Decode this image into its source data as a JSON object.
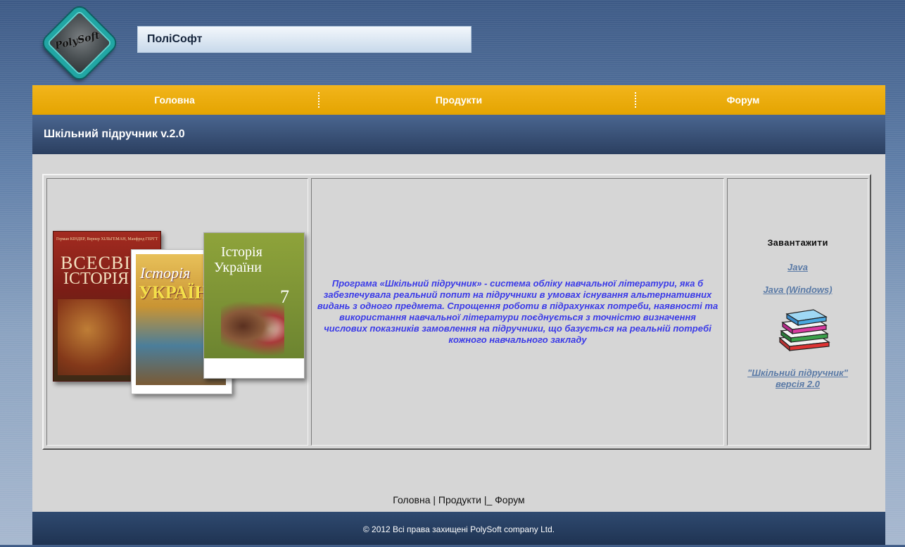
{
  "site": {
    "logo_text": "PolySoft",
    "name": "ПоліСофт"
  },
  "nav": {
    "items": [
      "Головна",
      "Продукти",
      "Форум"
    ]
  },
  "page": {
    "title": "Шкільний підручник v.2.0"
  },
  "books": {
    "book1": {
      "authors": "Герман КІНДЕР, Вернер ХІЛЬГЕМАН, Манфред ГЕРГТ",
      "title1": "ВСЕСВІТНЯ",
      "title2": "ІСТОРІЯ"
    },
    "book2": {
      "title1": "Історія",
      "title2": "УКРАЇНИ"
    },
    "book3": {
      "title1": "Історія",
      "title2": "України",
      "grade": "7"
    }
  },
  "description": "Програма «Шкільний підручник» - система обліку навчальної літератури, яка б забезпечувала реальний попит на підручники в умовах існування альтернативних видань з одного предмета. Спрощення роботи  в підрахунках потреби, наявності та використання навчальної літератури поєднується з точністю визначення числових показників замовлення на підручники, що базується на реальній потребі кожного навчального закладу",
  "download": {
    "title": "Завантажити",
    "java": "Java",
    "java_windows": "Java (Windows)",
    "version_line1": "\"Шкільний підручник\"",
    "version_line2": "версія 2.0",
    "icon": "books-icon"
  },
  "footer": {
    "links": [
      "Головна",
      "Продукти",
      "Форум"
    ],
    "copyright": "© 2012 Всі права захищені PolySoft company Ltd."
  },
  "colors": {
    "nav_bg": "#e4a400",
    "title_bar_bg": "#2b3f60",
    "description_text": "#3a3ae8",
    "link": "#5a7aa6",
    "content_bg": "#d6d6d6"
  }
}
